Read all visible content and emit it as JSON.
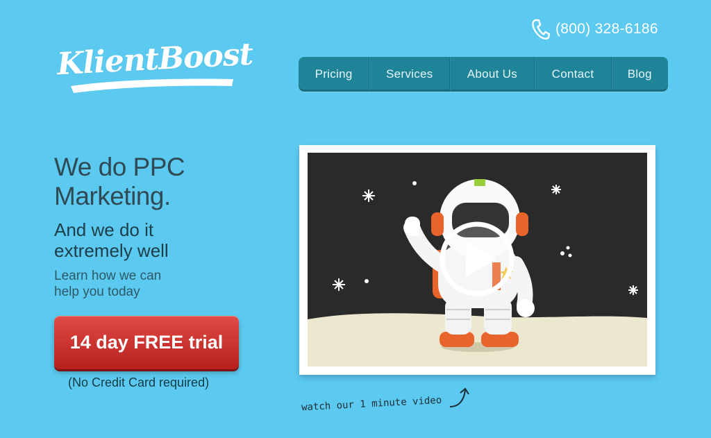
{
  "header": {
    "phone": "(800) 328-6186",
    "logo_text": "KlientBoost"
  },
  "nav": {
    "items": [
      {
        "label": "Pricing"
      },
      {
        "label": "Services"
      },
      {
        "label": "About Us"
      },
      {
        "label": "Contact"
      },
      {
        "label": "Blog"
      }
    ]
  },
  "hero": {
    "headline_line1": "We do PPC",
    "headline_line2": "Marketing.",
    "subhead_line1": "And we do it",
    "subhead_line2": "extremely well",
    "lead_line1": "Learn how we can",
    "lead_line2": "help you today",
    "cta_label": "14 day FREE trial",
    "cta_note": "(No Credit Card required)"
  },
  "video": {
    "caption": "watch our 1 minute video",
    "icons": [
      "astronaut-illustration",
      "play-icon",
      "curved-arrow-icon"
    ]
  },
  "colors": {
    "background": "#5ccaf0",
    "nav": "#1f8497",
    "cta": "#c9302c",
    "video_bg": "#2a2a2a"
  }
}
